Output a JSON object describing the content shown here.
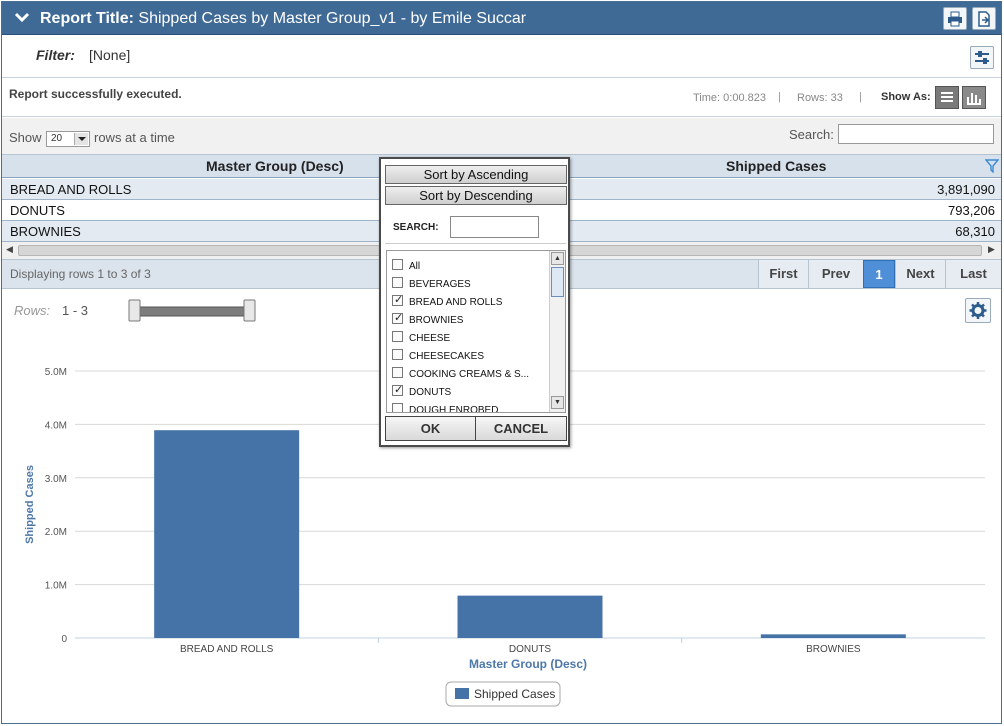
{
  "header": {
    "title_label": "Report Title:",
    "title_text": "Shipped Cases by Master Group_v1 - by Emile Succar"
  },
  "filter": {
    "label": "Filter:",
    "value": "[None]"
  },
  "status": {
    "message": "Report successfully executed.",
    "time": "Time: 0:00.823",
    "rows": "Rows: 33",
    "show_as": "Show As:"
  },
  "controls": {
    "show": "Show",
    "page_size": "20",
    "rows_at_a_time": "rows at a time",
    "search_label": "Search:"
  },
  "grid": {
    "headers": [
      "Master Group (Desc)",
      "Shipped Cases"
    ],
    "rows": [
      [
        "BREAD AND ROLLS",
        "3,891,090"
      ],
      [
        "DONUTS",
        "793,206"
      ],
      [
        "BROWNIES",
        "68,310"
      ]
    ]
  },
  "pager": {
    "display": "Displaying rows 1 to 3 of 3",
    "first": "First",
    "prev": "Prev",
    "page": "1",
    "next": "Next",
    "last": "Last"
  },
  "rows_range": {
    "label": "Rows:",
    "value": "1 - 3"
  },
  "popup": {
    "sort_asc": "Sort by Ascending",
    "sort_desc": "Sort by Descending",
    "search_label": "SEARCH:",
    "items": [
      {
        "label": "All",
        "checked": false
      },
      {
        "label": "BEVERAGES",
        "checked": false
      },
      {
        "label": "BREAD AND ROLLS",
        "checked": true
      },
      {
        "label": "BROWNIES",
        "checked": true
      },
      {
        "label": "CHEESE",
        "checked": false
      },
      {
        "label": "CHEESECAKES",
        "checked": false
      },
      {
        "label": "COOKING CREAMS & S...",
        "checked": false
      },
      {
        "label": "DONUTS",
        "checked": true
      },
      {
        "label": "DOUGH ENROBED",
        "checked": false
      }
    ],
    "ok": "OK",
    "cancel": "CANCEL"
  },
  "colors": {
    "accent": "#3f6a96",
    "bar": "#4572a7"
  },
  "chart_data": {
    "type": "bar",
    "categories": [
      "BREAD AND ROLLS",
      "DONUTS",
      "BROWNIES"
    ],
    "series": [
      {
        "name": "Shipped Cases",
        "values": [
          3891090,
          793206,
          68310
        ]
      }
    ],
    "xlabel": "Master Group (Desc)",
    "ylabel": "Shipped Cases",
    "ylim": [
      0,
      5000000
    ],
    "yticks": [
      0,
      1000000,
      2000000,
      3000000,
      4000000,
      5000000
    ],
    "ytick_labels": [
      "0",
      "1.0M",
      "2.0M",
      "3.0M",
      "4.0M",
      "5.0M"
    ],
    "grid": true,
    "legend": "bottom-center"
  }
}
